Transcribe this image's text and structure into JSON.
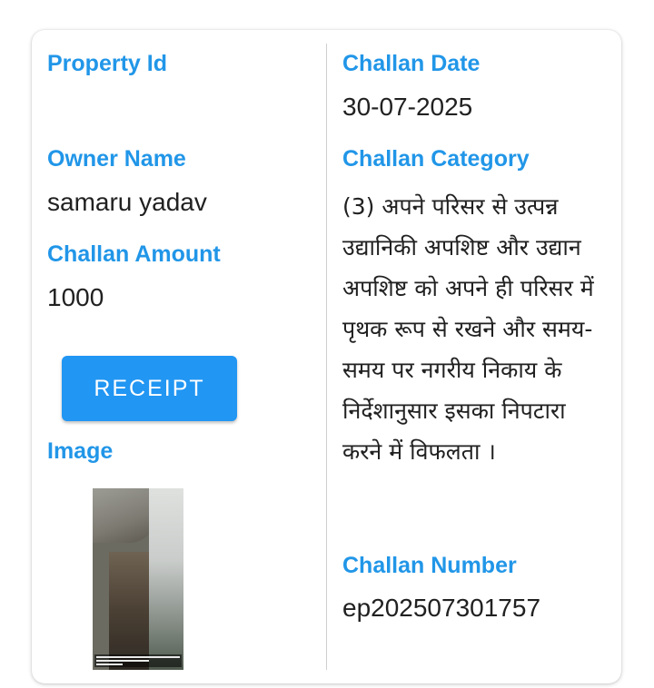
{
  "left": {
    "property_id_label": "Property Id",
    "property_id_value": "",
    "owner_name_label": "Owner Name",
    "owner_name_value": "samaru yadav",
    "challan_amount_label": "Challan Amount",
    "challan_amount_value": "1000",
    "receipt_button": "RECEIPT",
    "image_label": "Image"
  },
  "right": {
    "challan_date_label": "Challan Date",
    "challan_date_value": "30-07-2025",
    "challan_category_label": "Challan Category",
    "challan_category_value": "(3) अपने परिसर से उत्पन्न उद्यानिकी अपशिष्ट और उद्यान अपशिष्ट को अपने ही परिसर में पृथक रूप से रखने और समय-समय पर नगरीय निकाय के निर्देशानुसार इसका निपटारा करने में विफलता ।",
    "challan_number_label": "Challan Number",
    "challan_number_value": "ep202507301757"
  },
  "colors": {
    "label": "#2196e8",
    "button": "#2196f3",
    "text": "#212121"
  }
}
